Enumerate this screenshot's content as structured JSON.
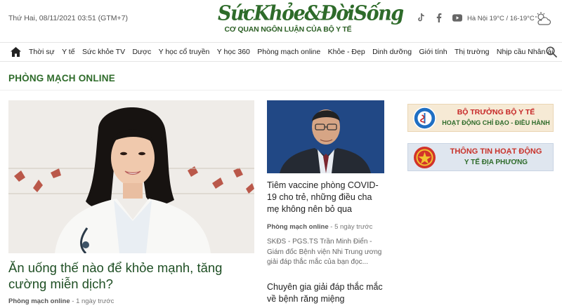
{
  "header": {
    "datetime": "Thứ Hai, 08/11/2021 03:51 (GTM+7)",
    "logo_text": "SứcKhỏe&ĐờiSống",
    "logo_tagline": "CƠ QUAN NGÔN LUẬN CỦA BỘ Y TẾ",
    "weather": "Hà Nội 19°C / 16-19°C",
    "social_icons": [
      "tiktok-icon",
      "facebook-icon",
      "youtube-icon"
    ],
    "weather_icon": "cloud-icon"
  },
  "nav": {
    "items": [
      "Thời sự",
      "Y tế",
      "Sức khỏe TV",
      "Dược",
      "Y học cổ truyền",
      "Y học 360",
      "Phòng mạch online",
      "Khỏe - Đẹp",
      "Dinh dưỡng",
      "Giới tính",
      "Thị trường",
      "Nhịp cầu Nhân ái"
    ]
  },
  "section": {
    "title": "PHÒNG MẠCH ONLINE"
  },
  "main_article": {
    "title": "Ăn uống thế nào để khỏe mạnh, tăng cường miễn dịch?",
    "category": "Phòng mạch online",
    "time": "- 1 ngày trước"
  },
  "side_articles": [
    {
      "title": "Tiêm vaccine phòng COVID-19 cho trẻ, những điều cha mẹ không nên bỏ qua",
      "category": "Phòng mạch online",
      "time": "- 5 ngày trước",
      "desc": "SKĐS - PGS.TS Trần Minh Điển - Giám đốc Bệnh viện Nhi Trung ương giải đáp thắc mắc của bạn đọc..."
    },
    {
      "title": "Chuyên gia giải đáp thắc mắc về bệnh răng miệng"
    }
  ],
  "banners": [
    {
      "line1": "BỘ TRƯỞNG BỘ Y TẾ",
      "line2": "HOẠT ĐỘNG CHỈ ĐẠO - ĐIỀU HÀNH"
    },
    {
      "line1": "THÔNG TIN HOẠT ĐỘNG",
      "line2": "Y TẾ ĐỊA PHƯƠNG"
    }
  ],
  "colors": {
    "brand_green": "#2e6b2a",
    "banner_red": "#c62626"
  }
}
